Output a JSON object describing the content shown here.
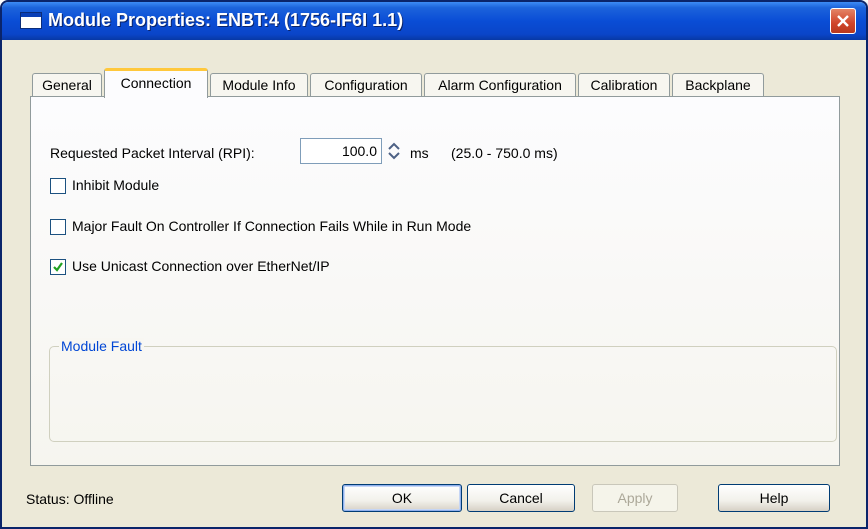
{
  "window": {
    "title": "Module Properties: ENBT:4 (1756-IF6I 1.1)"
  },
  "tabs": [
    {
      "label": "General",
      "active": false
    },
    {
      "label": "Connection",
      "active": true
    },
    {
      "label": "Module Info",
      "active": false
    },
    {
      "label": "Configuration",
      "active": false
    },
    {
      "label": "Alarm Configuration",
      "active": false
    },
    {
      "label": "Calibration",
      "active": false
    },
    {
      "label": "Backplane",
      "active": false
    }
  ],
  "connection": {
    "rpi_label": "Requested Packet Interval (RPI):",
    "rpi_value": "100.0",
    "rpi_unit": "ms",
    "rpi_range": "(25.0 - 750.0 ms)",
    "options": [
      {
        "label": "Inhibit Module",
        "checked": false
      },
      {
        "label": "Major Fault On Controller If Connection Fails While in Run Mode",
        "checked": false
      },
      {
        "label": "Use Unicast Connection over EtherNet/IP",
        "checked": true
      }
    ],
    "module_fault_label": "Module Fault",
    "module_fault_text": ""
  },
  "footer": {
    "status": "Status:  Offline",
    "ok_label": "OK",
    "cancel_label": "Cancel",
    "apply_label": "Apply",
    "help_label": "Help"
  },
  "colors": {
    "titlebar": "#0a4dd6",
    "active_tab_accent": "#ffc83c",
    "group_label": "#0046d5"
  }
}
